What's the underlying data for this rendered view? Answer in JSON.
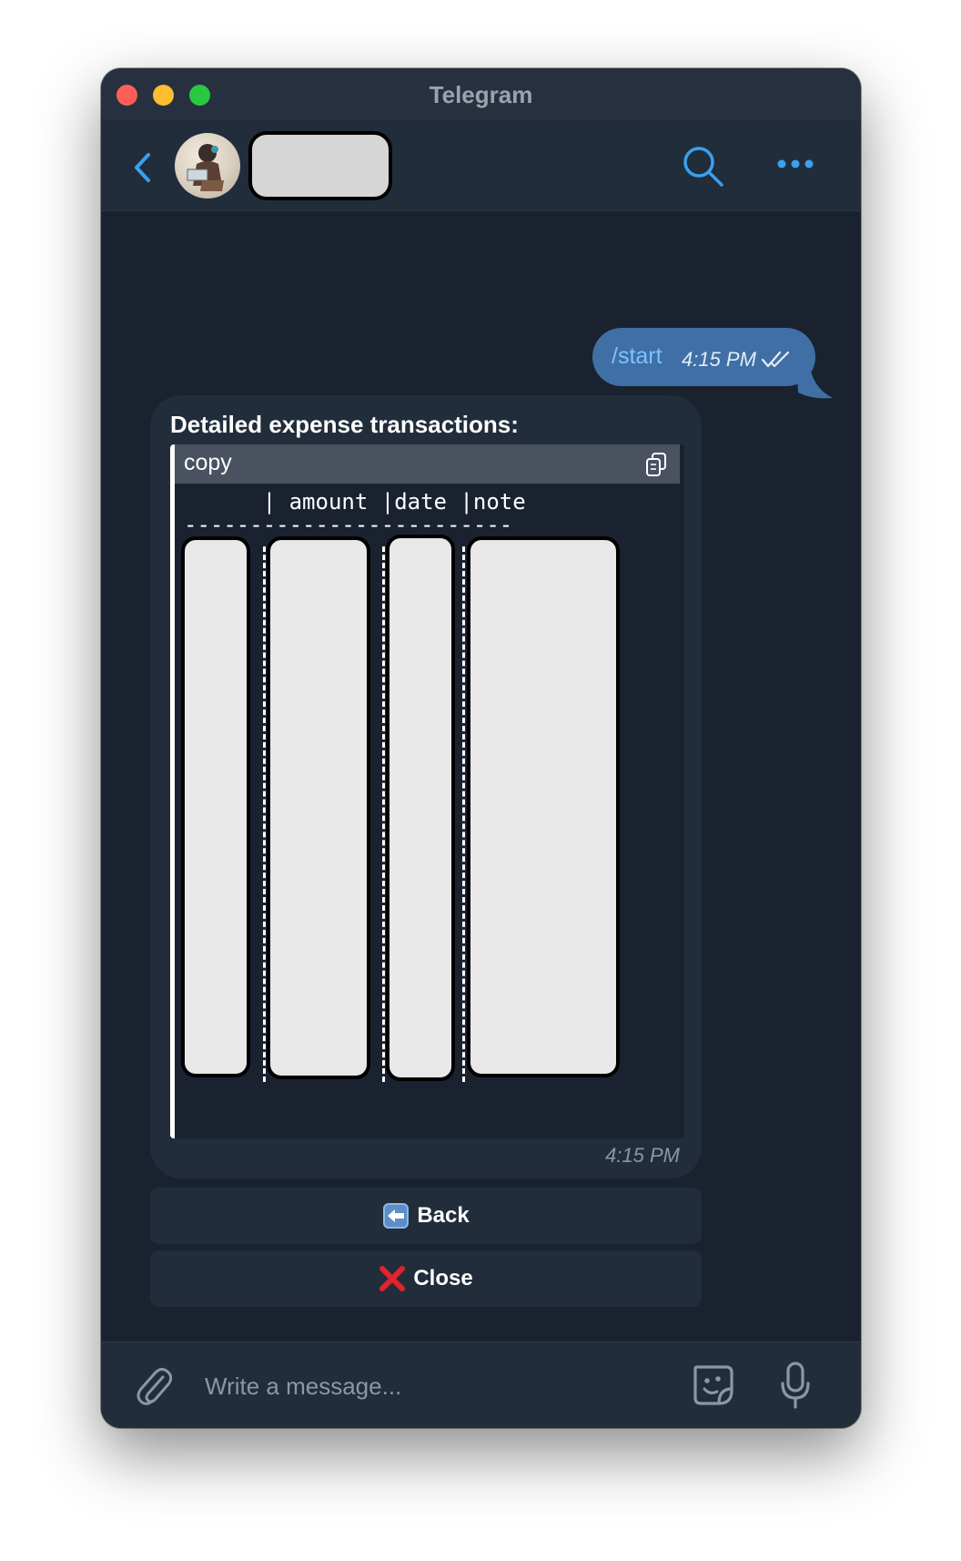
{
  "window": {
    "title": "Telegram"
  },
  "header": {
    "back_icon": "chevron-left-icon",
    "search_icon": "search-icon",
    "more_icon": "more-dots-icon",
    "accent_color": "#3aa0f0"
  },
  "outgoing": {
    "text": "/start",
    "time": "4:15 PM",
    "status_icon": "double-check-icon"
  },
  "incoming": {
    "title": "Detailed expense transactions:",
    "code_lang": "copy",
    "copy_icon": "copy-icon",
    "header_line": "      | amount |date |note",
    "rule_line": "-------------------------",
    "time": "4:15 PM"
  },
  "keyboard": {
    "back": {
      "emoji": "⬅️",
      "label": "Back"
    },
    "close": {
      "emoji": "❌",
      "label": "Close"
    }
  },
  "composer": {
    "placeholder": "Write a message...",
    "attach_icon": "paperclip-icon",
    "sticker_icon": "sticker-icon",
    "mic_icon": "microphone-icon"
  }
}
